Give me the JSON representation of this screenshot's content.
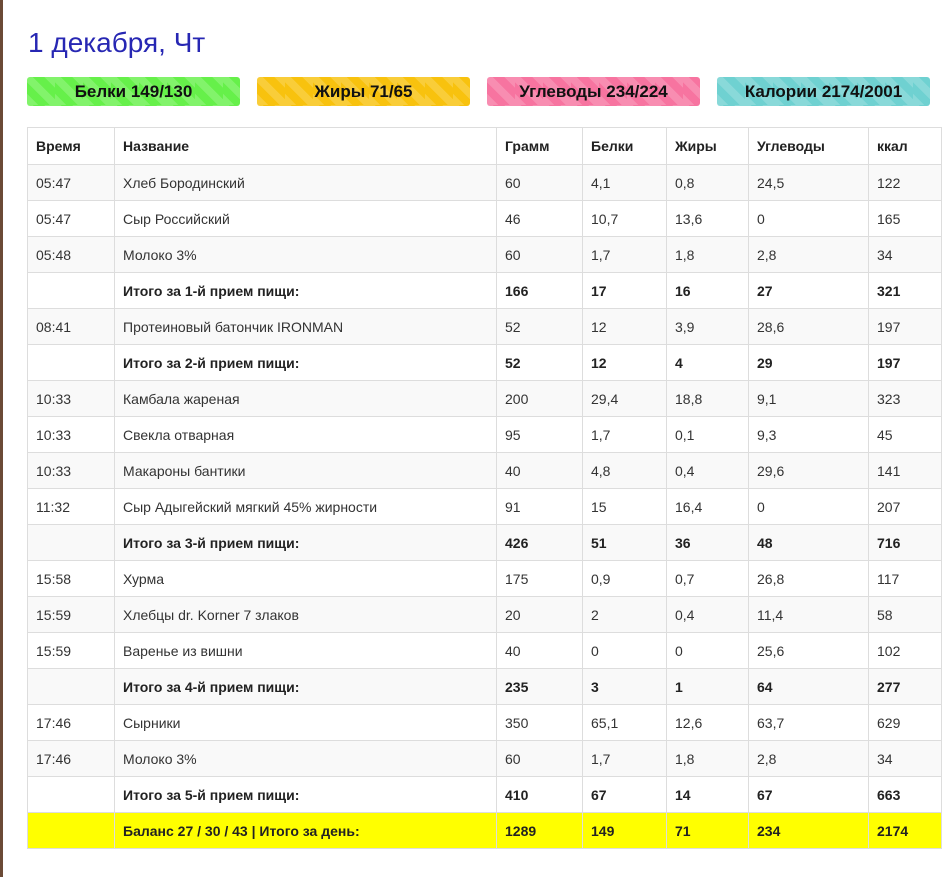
{
  "date_title": "1 декабря, Чт",
  "summary": {
    "protein": "Белки 149/130",
    "fat": "Жиры 71/65",
    "carbs": "Углеводы 234/224",
    "calories": "Калории 2174/2001"
  },
  "colors": {
    "title": "#2727b3",
    "protein": "#66f04a",
    "fat": "#f8c20e",
    "carbs": "#f774a0",
    "calories": "#6fd1d1",
    "day_total": "#ffff00"
  },
  "table": {
    "headers": [
      "Время",
      "Название",
      "Грамм",
      "Белки",
      "Жиры",
      "Углеводы",
      "ккал"
    ],
    "rows": [
      {
        "type": "item",
        "cells": [
          "05:47",
          "Хлеб Бородинский",
          "60",
          "4,1",
          "0,8",
          "24,5",
          "122"
        ]
      },
      {
        "type": "item",
        "cells": [
          "05:47",
          "Сыр Российский",
          "46",
          "10,7",
          "13,6",
          "0",
          "165"
        ]
      },
      {
        "type": "item",
        "cells": [
          "05:48",
          "Молоко 3%",
          "60",
          "1,7",
          "1,8",
          "2,8",
          "34"
        ]
      },
      {
        "type": "subtotal",
        "cells": [
          "",
          "Итого за 1-й прием пищи:",
          "166",
          "17",
          "16",
          "27",
          "321"
        ]
      },
      {
        "type": "item",
        "cells": [
          "08:41",
          "Протеиновый батончик IRONMAN",
          "52",
          "12",
          "3,9",
          "28,6",
          "197"
        ]
      },
      {
        "type": "subtotal",
        "cells": [
          "",
          "Итого за 2-й прием пищи:",
          "52",
          "12",
          "4",
          "29",
          "197"
        ]
      },
      {
        "type": "item",
        "cells": [
          "10:33",
          "Камбала жареная",
          "200",
          "29,4",
          "18,8",
          "9,1",
          "323"
        ]
      },
      {
        "type": "item",
        "cells": [
          "10:33",
          "Свекла отварная",
          "95",
          "1,7",
          "0,1",
          "9,3",
          "45"
        ]
      },
      {
        "type": "item",
        "cells": [
          "10:33",
          "Макароны бантики",
          "40",
          "4,8",
          "0,4",
          "29,6",
          "141"
        ]
      },
      {
        "type": "item",
        "cells": [
          "11:32",
          "Сыр Адыгейский мягкий 45% жирности",
          "91",
          "15",
          "16,4",
          "0",
          "207"
        ]
      },
      {
        "type": "subtotal",
        "cells": [
          "",
          "Итого за 3-й прием пищи:",
          "426",
          "51",
          "36",
          "48",
          "716"
        ]
      },
      {
        "type": "item",
        "cells": [
          "15:58",
          "Хурма",
          "175",
          "0,9",
          "0,7",
          "26,8",
          "117"
        ]
      },
      {
        "type": "item",
        "cells": [
          "15:59",
          "Хлебцы dr. Korner 7 злаков",
          "20",
          "2",
          "0,4",
          "11,4",
          "58"
        ]
      },
      {
        "type": "item",
        "cells": [
          "15:59",
          "Варенье из вишни",
          "40",
          "0",
          "0",
          "25,6",
          "102"
        ]
      },
      {
        "type": "subtotal",
        "cells": [
          "",
          "Итого за 4-й прием пищи:",
          "235",
          "3",
          "1",
          "64",
          "277"
        ]
      },
      {
        "type": "item",
        "cells": [
          "17:46",
          "Сырники",
          "350",
          "65,1",
          "12,6",
          "63,7",
          "629"
        ]
      },
      {
        "type": "item",
        "cells": [
          "17:46",
          "Молоко 3%",
          "60",
          "1,7",
          "1,8",
          "2,8",
          "34"
        ]
      },
      {
        "type": "subtotal",
        "cells": [
          "",
          "Итого за 5-й прием пищи:",
          "410",
          "67",
          "14",
          "67",
          "663"
        ]
      },
      {
        "type": "daytotal",
        "cells": [
          "",
          "Баланс 27 / 30 / 43 | Итого за день:",
          "1289",
          "149",
          "71",
          "234",
          "2174"
        ]
      }
    ]
  }
}
